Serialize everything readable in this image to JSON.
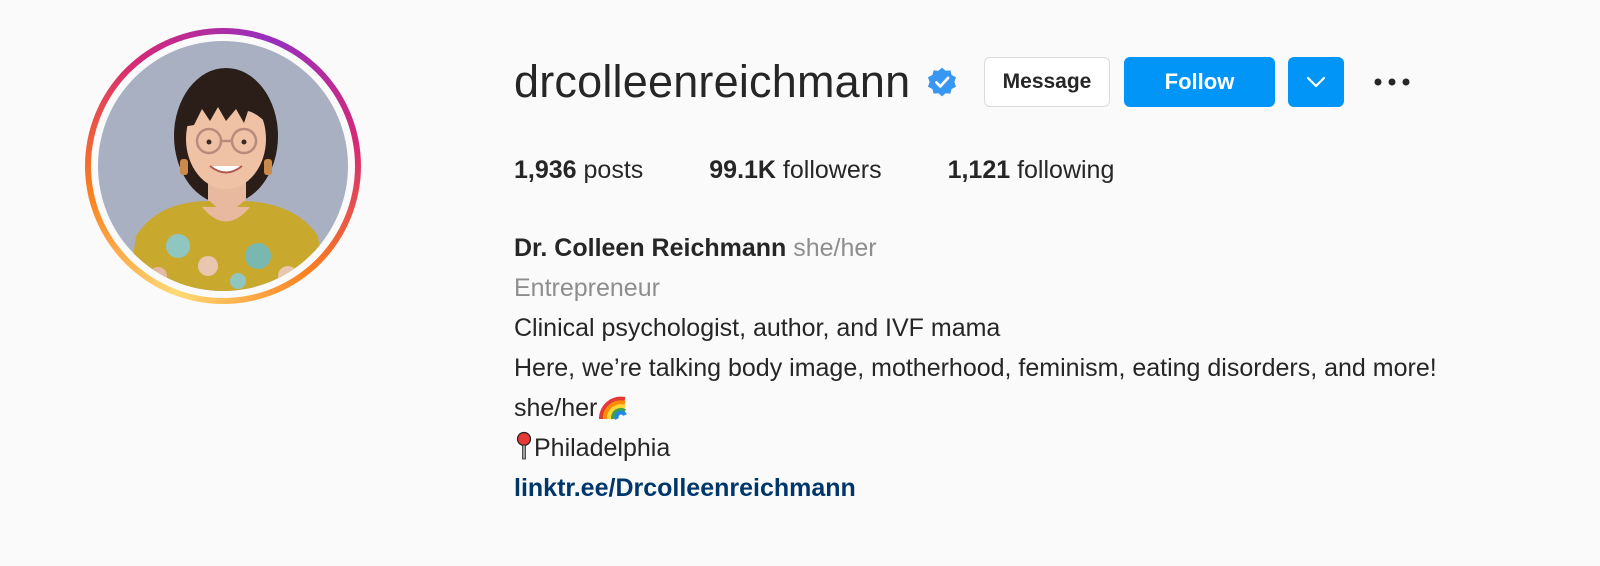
{
  "profile": {
    "username": "drcolleenreichmann",
    "verified_icon": "verified-badge-icon",
    "avatar_icon": "profile-photo"
  },
  "actions": {
    "message_label": "Message",
    "follow_label": "Follow",
    "dropdown_icon": "chevron-down-icon",
    "more_icon": "more-options-icon"
  },
  "stats": {
    "posts_count": "1,936",
    "posts_label": " posts",
    "followers_count": "99.1K",
    "followers_label": " followers",
    "following_count": "1,121",
    "following_label": " following"
  },
  "bio": {
    "full_name": "Dr. Colleen Reichmann",
    "pronouns": "she/her",
    "category": "Entrepreneur",
    "line1": "Clinical psychologist, author, and IVF mama",
    "line2": "Here, we’re talking body image, motherhood, feminism, eating disorders, and more!",
    "line3": "she/her",
    "line3_emoji": "rainbow-icon",
    "line4_emoji": "pin-icon",
    "line4": "Philadelphia",
    "link": "linktr.ee/Drcolleenreichmann"
  },
  "colors": {
    "follow_blue": "#0095f6",
    "link_blue": "#00376b",
    "muted_gray": "#8e8e8e",
    "text": "#262626",
    "background": "#fafafa"
  }
}
